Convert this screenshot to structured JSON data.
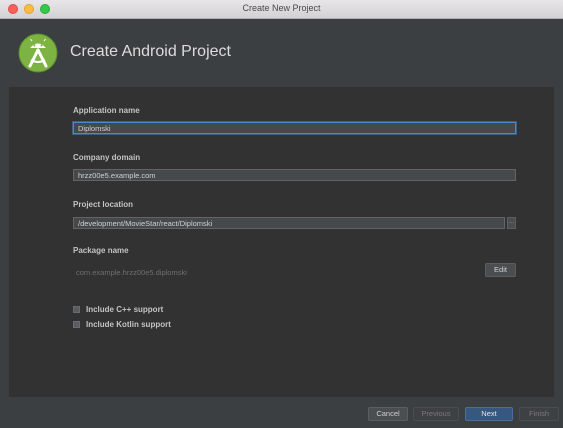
{
  "window": {
    "title": "Create New Project"
  },
  "header": {
    "title": "Create Android Project",
    "logo_icon": "android-studio-icon"
  },
  "form": {
    "application_name": {
      "label": "Application name",
      "value": "Diplomski"
    },
    "company_domain": {
      "label": "Company domain",
      "value": "hrzz00e5.example.com"
    },
    "project_location": {
      "label": "Project location",
      "value": "/development/MovieStar/react/Diplomski",
      "browse_label": "..."
    },
    "package_name": {
      "label": "Package name",
      "value": "com.example.hrzz00e5.diplomski",
      "edit_label": "Edit"
    },
    "cpp_support": {
      "label": "Include C++ support",
      "checked": false
    },
    "kotlin_support": {
      "label": "Include Kotlin support",
      "checked": false
    }
  },
  "footer": {
    "cancel": "Cancel",
    "previous": "Previous",
    "next": "Next",
    "finish": "Finish"
  },
  "colors": {
    "accent": "#365880",
    "focus": "#4a88c7",
    "background": "#3c3f41",
    "android_green": "#a4c639"
  }
}
